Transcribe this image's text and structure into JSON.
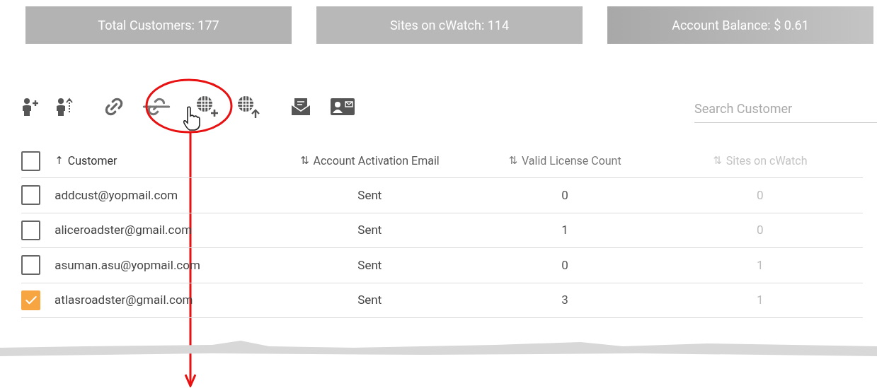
{
  "stats": [
    {
      "label": "Total Customers: 177"
    },
    {
      "label": "Sites on cWatch: 114"
    },
    {
      "label": "Account Balance: $ 0.61"
    }
  ],
  "search": {
    "placeholder": "Search Customer"
  },
  "table": {
    "select_all": {
      "checked": false
    },
    "columns": [
      {
        "label": "Customer",
        "sort": "↑"
      },
      {
        "label": "Account Activation Email",
        "sort": "⇅"
      },
      {
        "label": "Valid License Count",
        "sort": "⇅"
      },
      {
        "label": "Sites on cWatch",
        "sort": "⇅"
      }
    ],
    "rows": [
      {
        "selected": false,
        "cells": [
          "addcust@yopmail.com",
          "Sent",
          "0",
          "0"
        ]
      },
      {
        "selected": false,
        "cells": [
          "aliceroadster@gmail.com",
          "Sent",
          "1",
          "0"
        ]
      },
      {
        "selected": false,
        "cells": [
          "asuman.asu@yopmail.com",
          "Sent",
          "0",
          "1"
        ]
      },
      {
        "selected": true,
        "cells": [
          "atlasroadster@gmail.com",
          "Sent",
          "3",
          "1"
        ]
      }
    ]
  }
}
